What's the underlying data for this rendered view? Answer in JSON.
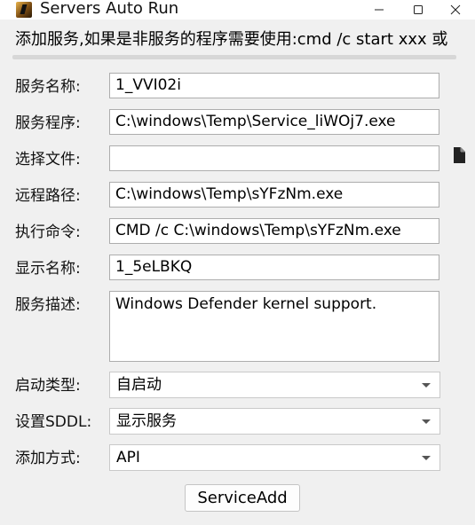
{
  "window": {
    "title": "Servers Auto Run",
    "icon": "app-icon",
    "controls": {
      "minimize": "minimize-icon",
      "maximize": "maximize-icon",
      "close": "close-icon"
    }
  },
  "info_text": "添加服务,如果是非服务的程序需要使用:cmd /c start xxx 或",
  "form": {
    "service_name": {
      "label": "服务名称:",
      "value": "1_VVI02i"
    },
    "service_program": {
      "label": "服务程序:",
      "value": "C:\\windows\\Temp\\Service_liWOj7.exe"
    },
    "select_file": {
      "label": "选择文件:",
      "value": "",
      "button_icon": "file-icon"
    },
    "remote_path": {
      "label": "远程路径:",
      "value": "C:\\windows\\Temp\\sYFzNm.exe"
    },
    "exec_command": {
      "label": "执行命令:",
      "value": "CMD /c C:\\windows\\Temp\\sYFzNm.exe"
    },
    "display_name": {
      "label": "显示名称:",
      "value": "1_5eLBKQ"
    },
    "description": {
      "label": "服务描述:",
      "value": "Windows Defender kernel support."
    },
    "start_type": {
      "label": "启动类型:",
      "value": "自启动"
    },
    "sddl": {
      "label": "设置SDDL:",
      "value": "显示服务"
    },
    "add_method": {
      "label": "添加方式:",
      "value": "API"
    }
  },
  "submit_label": "ServiceAdd"
}
